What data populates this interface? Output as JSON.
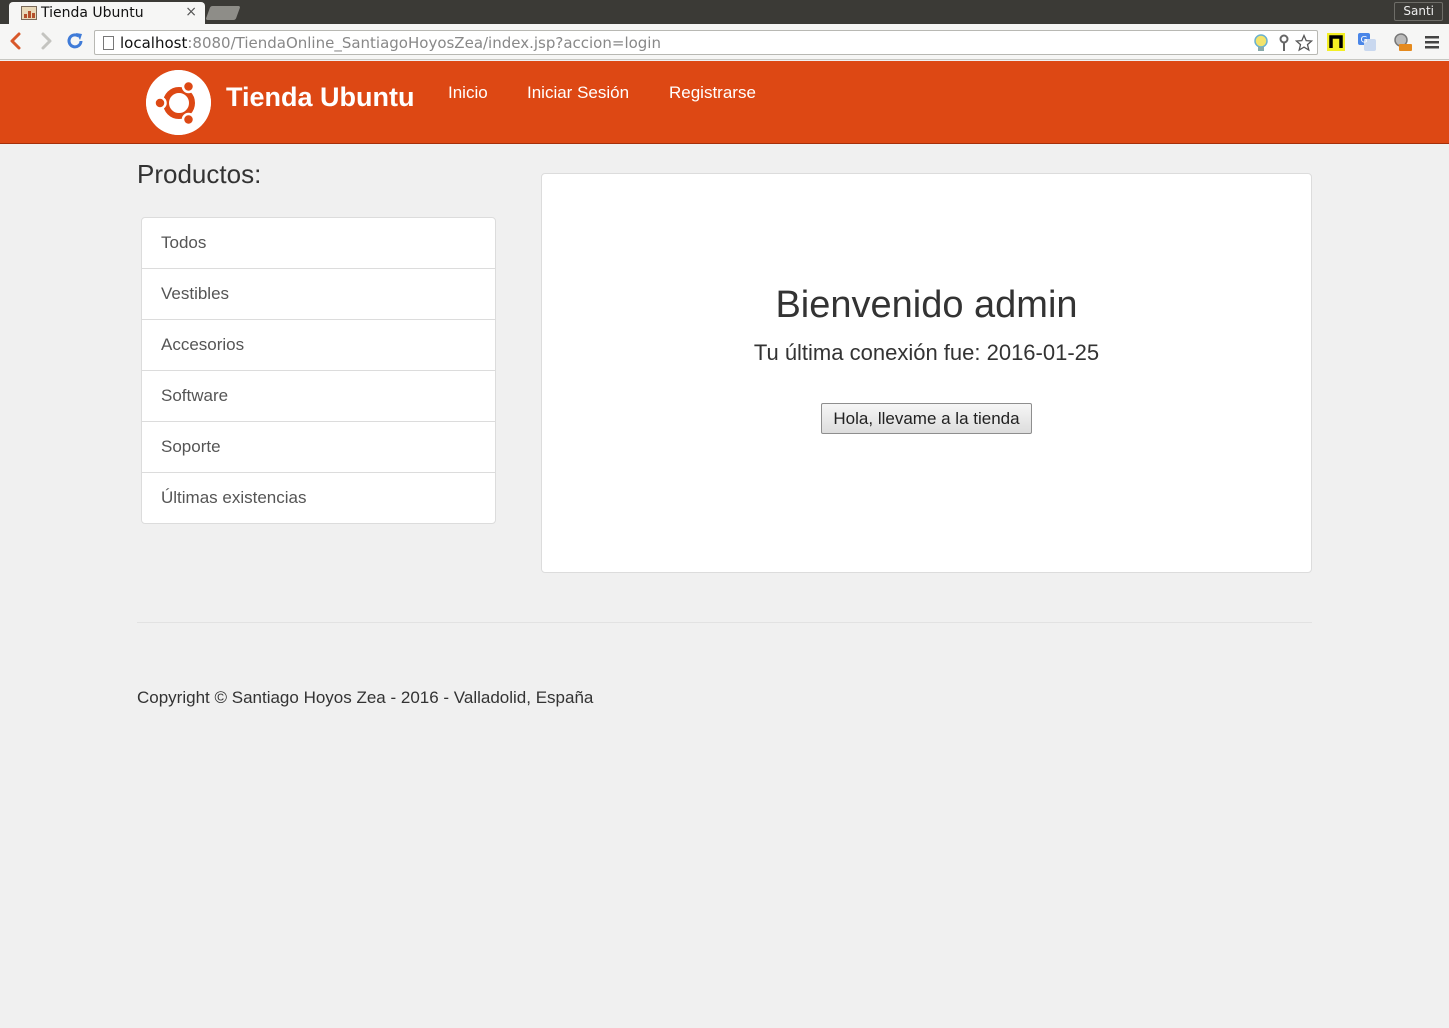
{
  "browser": {
    "tab_title": "Tienda Ubuntu",
    "tab_close": "×",
    "profile_name": "Santi",
    "url_host": "localhost",
    "url_rest": ":8080/TiendaOnline_SantiagoHoyosZea/index.jsp?accion=login"
  },
  "navbar": {
    "brand": "Tienda Ubuntu",
    "links": [
      "Inicio",
      "Iniciar Sesión",
      "Registrarse"
    ],
    "background_color": "#dd4814"
  },
  "sidebar": {
    "title": "Productos:",
    "items": [
      "Todos",
      "Vestibles",
      "Accesorios",
      "Software",
      "Soporte",
      "Últimas existencias"
    ]
  },
  "main": {
    "welcome": "Bienvenido admin",
    "last_login": "Tu última conexión fue: 2016-01-25",
    "button_label": "Hola, llevame a la tienda"
  },
  "footer": {
    "copyright": "Copyright © Santiago Hoyos Zea - 2016 - Valladolid, España"
  }
}
